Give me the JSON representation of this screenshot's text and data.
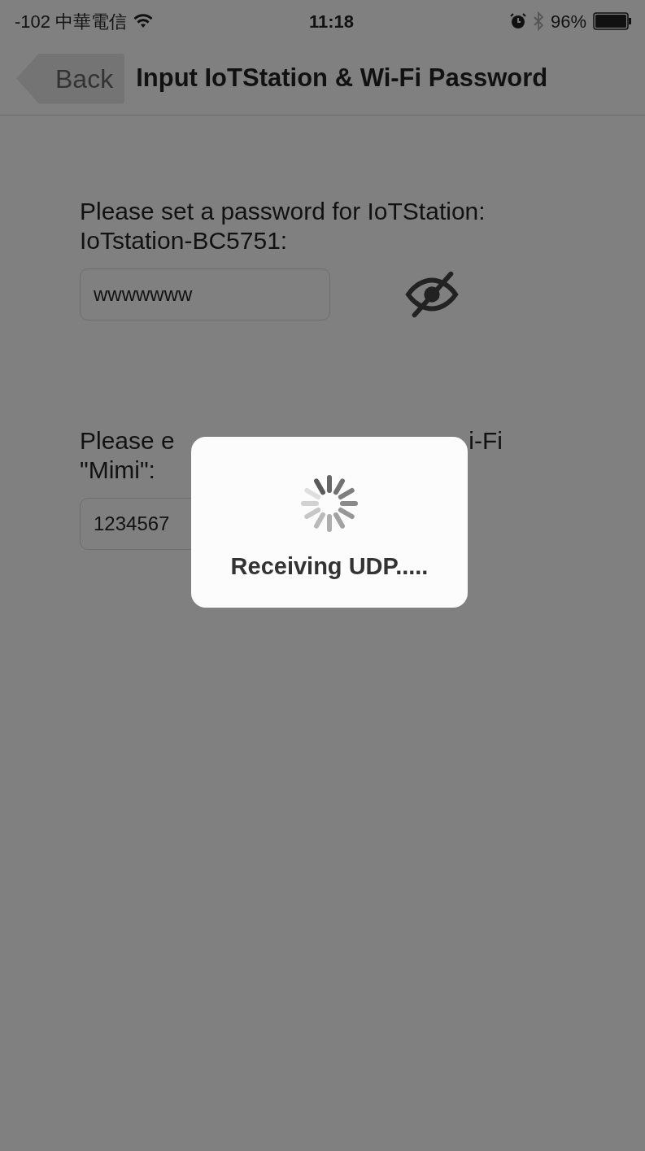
{
  "status_bar": {
    "carrier": "-102 中華電信",
    "time": "11:18",
    "battery": "96%"
  },
  "nav_bar": {
    "back": "Back",
    "title": "Input IoTStation & Wi-Fi Password"
  },
  "sections": [
    {
      "label_lines": [
        [
          "Please set a password for IoTStation:"
        ],
        [
          "IoTstation-BC5751:"
        ]
      ],
      "value": "wwwwwww"
    },
    {
      "label_lines": [
        [
          "Please e",
          "i-Fi"
        ],
        [
          "\"Mimi\":"
        ]
      ],
      "value": "1234567"
    }
  ],
  "hud": {
    "message": "Receiving UDP....."
  }
}
